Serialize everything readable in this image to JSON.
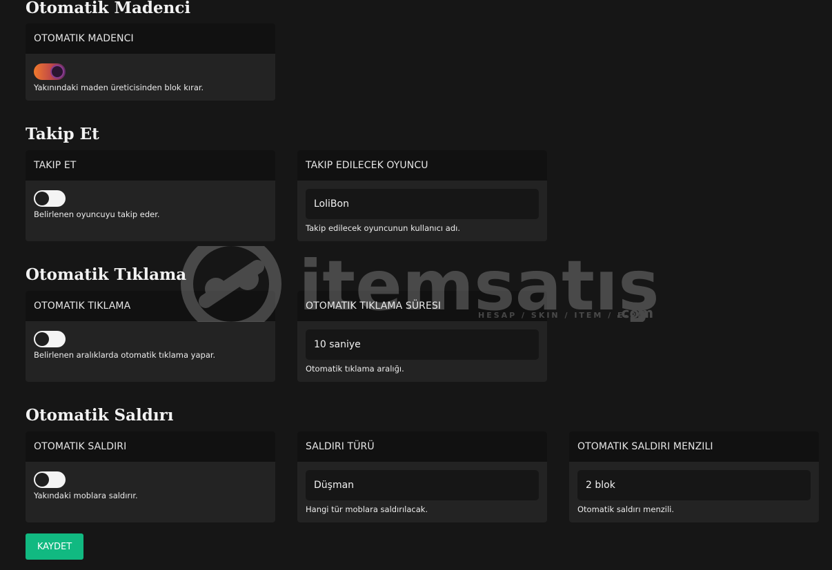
{
  "sections": {
    "miner": {
      "title": "Otomatik Madenci",
      "card": {
        "header": "OTOMATIK MADENCI",
        "enabled": true,
        "description": "Yakınındaki maden üreticisinden blok kırar."
      }
    },
    "follow": {
      "title": "Takip Et",
      "card": {
        "header": "TAKIP ET",
        "enabled": false,
        "description": "Belirlenen oyuncuyu takip eder."
      },
      "player": {
        "header": "TAKIP EDILECEK OYUNCU",
        "value": "LoliBon",
        "description": "Takip edilecek oyuncunun kullanıcı adı."
      }
    },
    "autoclick": {
      "title": "Otomatik Tıklama",
      "card": {
        "header": "OTOMATIK TIKLAMA",
        "enabled": false,
        "description": "Belirlenen aralıklarda otomatik tıklama yapar."
      },
      "interval": {
        "header": "OTOMATIK TIKLAMA SÜRESI",
        "value": "10 saniye",
        "description": "Otomatik tıklama aralığı."
      }
    },
    "attack": {
      "title": "Otomatik Saldırı",
      "card": {
        "header": "OTOMATIK SALDIRI",
        "enabled": false,
        "description": "Yakındaki moblara saldırır."
      },
      "type": {
        "header": "SALDIRI TÜRÜ",
        "value": "Düşman",
        "description": "Hangi tür moblara saldırılacak."
      },
      "range": {
        "header": "OTOMATIK SALDIRI MENZILI",
        "value": "2 blok",
        "description": "Otomatik saldırı menzili."
      }
    }
  },
  "save_label": "KAYDET",
  "watermark": {
    "brand": "itemsatış",
    "tagline": "HESAP / SKIN / ITEM / E-PIN",
    "suffix": ".com"
  },
  "colors": {
    "accent": "#11b981",
    "toggle_on_start": "#f07a2c",
    "toggle_on_end": "#5b2a6a"
  }
}
